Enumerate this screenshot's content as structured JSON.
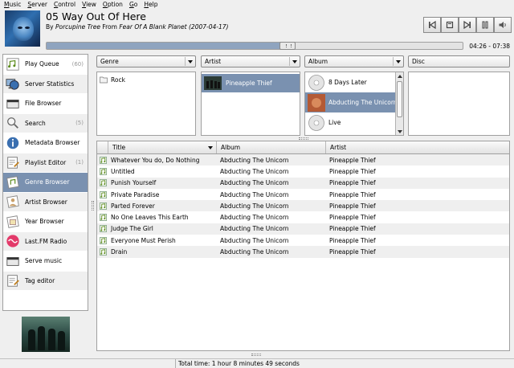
{
  "menu": [
    {
      "label": "Music",
      "key": "M"
    },
    {
      "label": "Server",
      "key": "S"
    },
    {
      "label": "Control",
      "key": "C"
    },
    {
      "label": "View",
      "key": "V"
    },
    {
      "label": "Option",
      "key": "O"
    },
    {
      "label": "Go",
      "key": "G"
    },
    {
      "label": "Help",
      "key": "H"
    }
  ],
  "now_playing": {
    "title": "05 Way Out Of Here",
    "by_label": "By",
    "artist": "Porcupine Tree",
    "from_label": "From",
    "album": "Fear Of A Blank Planet",
    "year": "(2007-04-17)",
    "elapsed": "04:26",
    "separator": "-",
    "total": "07:38",
    "progress_fraction": 0.58
  },
  "controls": [
    "prev-icon",
    "stop-icon",
    "next-icon",
    "play-pause-icon",
    "volume-icon"
  ],
  "sidebar": {
    "items": [
      {
        "label": "Play Queue",
        "count": "(60)",
        "icon": "queue-icon"
      },
      {
        "label": "Server Statistics",
        "count": "",
        "icon": "server-icon"
      },
      {
        "label": "File Browser",
        "count": "",
        "icon": "folder-icon"
      },
      {
        "label": "Search",
        "count": "(5)",
        "icon": "search-icon"
      },
      {
        "label": "Metadata Browser",
        "count": "",
        "icon": "info-icon"
      },
      {
        "label": "Playlist Editor",
        "count": "(1)",
        "icon": "playlist-icon"
      },
      {
        "label": "Genre Browser",
        "count": "",
        "icon": "genre-icon"
      },
      {
        "label": "Artist Browser",
        "count": "",
        "icon": "artist-icon"
      },
      {
        "label": "Year Browser",
        "count": "",
        "icon": "year-icon"
      },
      {
        "label": "Last.FM Radio",
        "count": "",
        "icon": "lastfm-icon"
      },
      {
        "label": "Serve music",
        "count": "",
        "icon": "serve-icon"
      },
      {
        "label": "Tag editor",
        "count": "",
        "icon": "tag-icon"
      }
    ],
    "selected_index": 6
  },
  "browser": {
    "genre": {
      "label": "Genre",
      "items": [
        "Rock"
      ]
    },
    "artist": {
      "label": "Artist",
      "items": [
        "Pineapple Thief"
      ],
      "selected": 0
    },
    "album": {
      "label": "Album",
      "items": [
        "8 Days Later",
        "Abducting The Unicorn",
        "Live"
      ],
      "selected": 1
    },
    "disc": {
      "label": "Disc",
      "items": []
    }
  },
  "table": {
    "columns": [
      "Title",
      "Album",
      "Artist"
    ],
    "rows": [
      {
        "title": "Whatever You do, Do Nothing",
        "album": "Abducting The Unicorn",
        "artist": "Pineapple Thief"
      },
      {
        "title": "Untitled",
        "album": "Abducting The Unicorn",
        "artist": "Pineapple Thief"
      },
      {
        "title": "Punish Yourself",
        "album": "Abducting The Unicorn",
        "artist": "Pineapple Thief"
      },
      {
        "title": "Private Paradise",
        "album": "Abducting The Unicorn",
        "artist": "Pineapple Thief"
      },
      {
        "title": "Parted Forever",
        "album": "Abducting The Unicorn",
        "artist": "Pineapple Thief"
      },
      {
        "title": "No One Leaves This Earth",
        "album": "Abducting The Unicorn",
        "artist": "Pineapple Thief"
      },
      {
        "title": "Judge The Girl",
        "album": "Abducting The Unicorn",
        "artist": "Pineapple Thief"
      },
      {
        "title": "Everyone Must Perish",
        "album": "Abducting The Unicorn",
        "artist": "Pineapple Thief"
      },
      {
        "title": "Drain",
        "album": "Abducting The Unicorn",
        "artist": "Pineapple Thief"
      }
    ]
  },
  "status": {
    "total_time": "Total time: 1 hour 8 minutes 49 seconds"
  },
  "colors": {
    "selection": "#7a91b0",
    "progress": "#8fa4bf"
  }
}
